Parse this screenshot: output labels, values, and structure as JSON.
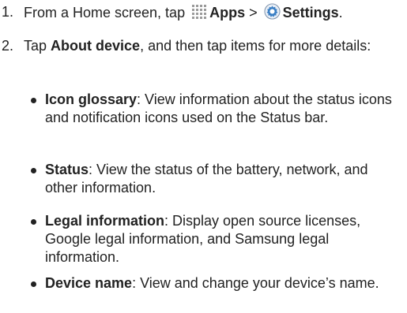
{
  "steps": [
    {
      "number": "1.",
      "prefix": "From a Home screen, tap",
      "apps_label": "Apps",
      "separator": ">",
      "settings_label": "Settings",
      "suffix": ".",
      "apps_icon": "apps-grid-icon",
      "settings_icon": "settings-gear-icon"
    },
    {
      "number": "2.",
      "prefix": "Tap",
      "bold": "About device",
      "suffix": ", and then tap items for more details:"
    }
  ],
  "bullets": [
    {
      "term": "Icon glossary",
      "desc": ": View information about the status icons and notification icons used on the Status bar."
    },
    {
      "term": "Status",
      "desc": ": View the status of the battery, network, and other information."
    },
    {
      "term": "Legal information",
      "desc": ": Display open source licenses, Google legal information, and Samsung legal information."
    },
    {
      "term": "Device name",
      "desc": ": View and change your device’s name."
    }
  ],
  "colors": {
    "text": "#222222",
    "icon_gray": "#9a9a9a",
    "gear_blue": "#3b7fc4"
  }
}
